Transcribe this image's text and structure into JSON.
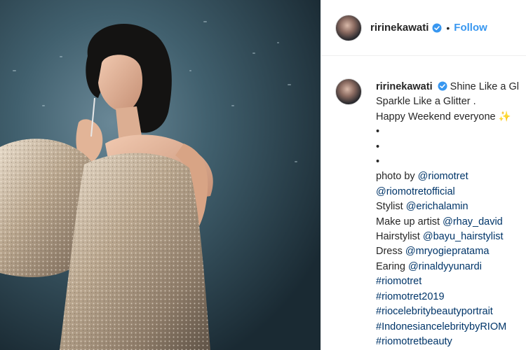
{
  "post": {
    "username": "ririnekawati",
    "follow_label": "Follow",
    "separator": "•"
  },
  "caption": {
    "username": "ririnekawati",
    "line1_text": "Shine Like a Gl",
    "line2": "Sparkle Like a Glitter .",
    "line3": "Happy Weekend everyone",
    "line3_emoji": "✨",
    "bullets": [
      "•",
      "•",
      "•"
    ],
    "credits": [
      {
        "label": "photo by ",
        "handle": "@riomotret"
      },
      {
        "label": "",
        "handle": "@riomotretofficial"
      },
      {
        "label": "Stylist ",
        "handle": "@erichalamin"
      },
      {
        "label": "Make up artist ",
        "handle": "@rhay_david"
      },
      {
        "label": "Hairstylist ",
        "handle": "@bayu_hairstylist"
      },
      {
        "label": "Dress ",
        "handle": "@mryogiepratama"
      },
      {
        "label": "Earing ",
        "handle": "@rinaldyyunardi"
      }
    ],
    "hashtags": [
      "#riomotret",
      "#riomotret2019",
      "#riocelebritybeautyportrait",
      "#IndonesiancelebritybyRIOM",
      "#riomotretbeauty"
    ]
  },
  "colors": {
    "link": "#003569",
    "follow": "#3897f0",
    "verified": "#3897f0",
    "text": "#262626"
  },
  "icons": [
    "verified-badge-icon"
  ]
}
